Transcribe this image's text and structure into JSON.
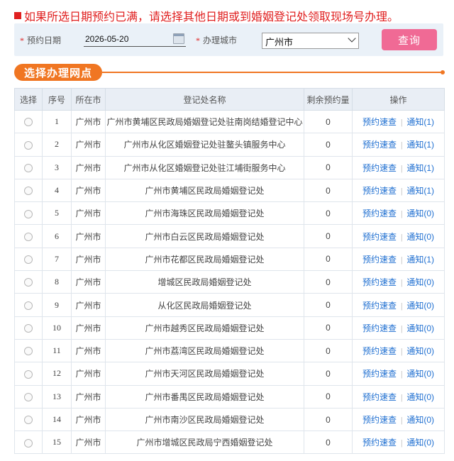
{
  "notice": "如果所选日期预约已满，请选择其他日期或到婚姻登记处领取现场号办理。",
  "filter": {
    "date_label": "预约日期",
    "date_value": "2026-05-20",
    "city_label": "办理城市",
    "city_value": "广州市",
    "query_label": "查询"
  },
  "section_title": "选择办理网点",
  "table": {
    "headers": [
      "选择",
      "序号",
      "所在市",
      "登记处名称",
      "剩余预约量",
      "操作"
    ],
    "rows": [
      {
        "no": "1",
        "city": "广州市",
        "name": "广州市黄埔区民政局婚姻登记处驻南岗结婚登记中心",
        "remain": "0",
        "book": "预约速查",
        "notice": "通知(1)"
      },
      {
        "no": "2",
        "city": "广州市",
        "name": "广州市从化区婚姻登记处驻鳌头镇服务中心",
        "remain": "0",
        "book": "预约速查",
        "notice": "通知(1)"
      },
      {
        "no": "3",
        "city": "广州市",
        "name": "广州市从化区婚姻登记处驻江埔街服务中心",
        "remain": "0",
        "book": "预约速查",
        "notice": "通知(1)"
      },
      {
        "no": "4",
        "city": "广州市",
        "name": "广州市黄埔区民政局婚姻登记处",
        "remain": "0",
        "book": "预约速查",
        "notice": "通知(1)"
      },
      {
        "no": "5",
        "city": "广州市",
        "name": "广州市海珠区民政局婚姻登记处",
        "remain": "0",
        "book": "预约速查",
        "notice": "通知(0)"
      },
      {
        "no": "6",
        "city": "广州市",
        "name": "广州市白云区民政局婚姻登记处",
        "remain": "0",
        "book": "预约速查",
        "notice": "通知(0)"
      },
      {
        "no": "7",
        "city": "广州市",
        "name": "广州市花都区民政局婚姻登记处",
        "remain": "0",
        "book": "预约速查",
        "notice": "通知(1)"
      },
      {
        "no": "8",
        "city": "广州市",
        "name": "增城区民政局婚姻登记处",
        "remain": "0",
        "book": "预约速查",
        "notice": "通知(0)"
      },
      {
        "no": "9",
        "city": "广州市",
        "name": "从化区民政局婚姻登记处",
        "remain": "0",
        "book": "预约速查",
        "notice": "通知(0)"
      },
      {
        "no": "10",
        "city": "广州市",
        "name": "广州市越秀区民政局婚姻登记处",
        "remain": "0",
        "book": "预约速查",
        "notice": "通知(0)"
      },
      {
        "no": "11",
        "city": "广州市",
        "name": "广州市荔湾区民政局婚姻登记处",
        "remain": "0",
        "book": "预约速查",
        "notice": "通知(0)"
      },
      {
        "no": "12",
        "city": "广州市",
        "name": "广州市天河区民政局婚姻登记处",
        "remain": "0",
        "book": "预约速查",
        "notice": "通知(0)"
      },
      {
        "no": "13",
        "city": "广州市",
        "name": "广州市番禺区民政局婚姻登记处",
        "remain": "0",
        "book": "预约速查",
        "notice": "通知(0)"
      },
      {
        "no": "14",
        "city": "广州市",
        "name": "广州市南沙区民政局婚姻登记处",
        "remain": "0",
        "book": "预约速查",
        "notice": "通知(0)"
      },
      {
        "no": "15",
        "city": "广州市",
        "name": "广州市增城区民政局宁西婚姻登记处",
        "remain": "0",
        "book": "预约速查",
        "notice": "通知(0)"
      }
    ]
  },
  "colors": {
    "accent": "#f07622",
    "alert": "#e02020",
    "button": "#f06a95",
    "link": "#1f6fd1"
  }
}
